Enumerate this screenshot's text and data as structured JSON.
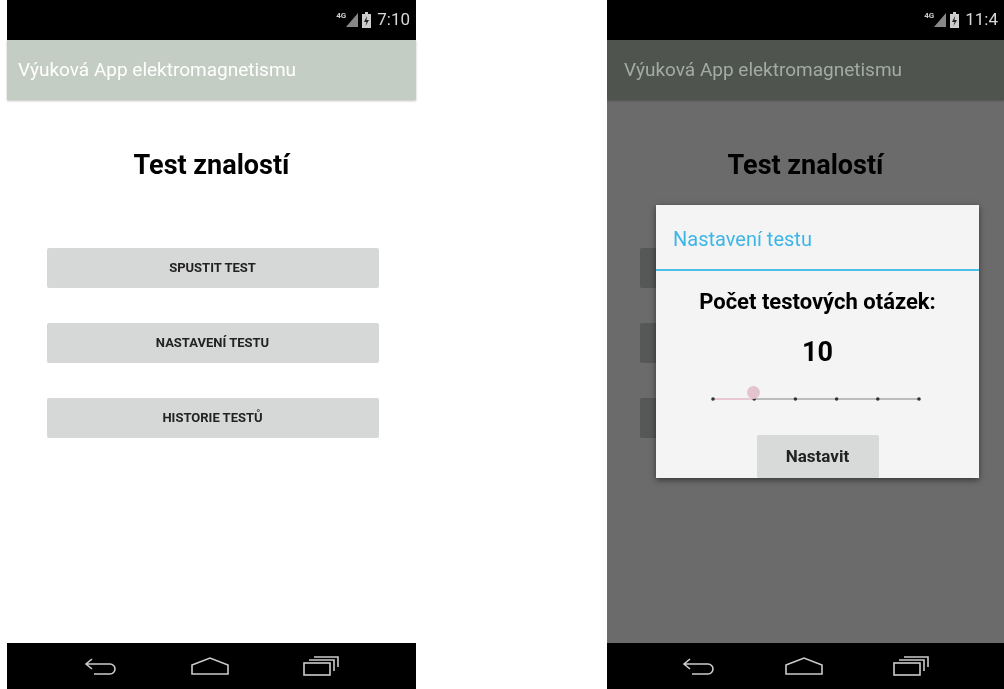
{
  "screens": [
    {
      "status_bar": {
        "network": "4G",
        "time": "7:10"
      },
      "app_bar": {
        "title": "Výuková App elektromagnetismu"
      },
      "heading": "Test znalostí",
      "buttons": [
        "SPUSTIT TEST",
        "NASTAVENÍ TESTU",
        "HISTORIE TESTŮ"
      ],
      "dialog_open": false
    },
    {
      "status_bar": {
        "network": "4G",
        "time": "11:4"
      },
      "app_bar": {
        "title": "Výuková App elektromagnetismu"
      },
      "heading": "Test znalostí",
      "dialog_open": true,
      "dialog": {
        "title": "Nastavení testu",
        "label": "Počet testových otázek:",
        "value": "10",
        "slider": {
          "level": 0.2
        },
        "button": "Nastavit"
      }
    }
  ]
}
